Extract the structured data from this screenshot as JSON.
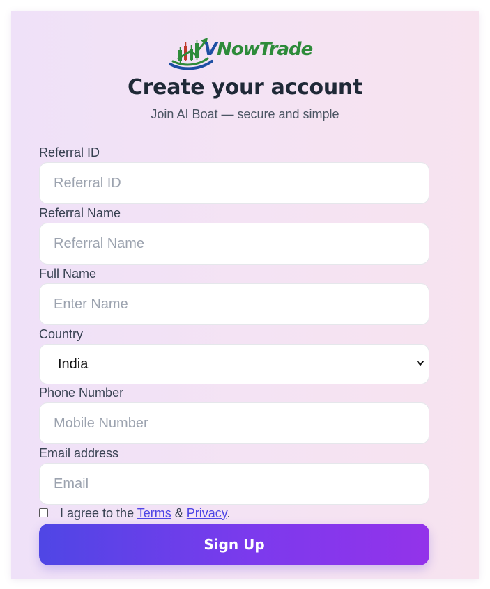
{
  "brand": {
    "logo_text_v": "V",
    "logo_text_rest": "NowTrade"
  },
  "header": {
    "title": "Create your account",
    "subtitle": "Join AI Boat — secure and simple"
  },
  "form": {
    "referral_id": {
      "label": "Referral ID",
      "placeholder": "Referral ID",
      "value": ""
    },
    "referral_name": {
      "label": "Referral Name",
      "placeholder": "Referral Name",
      "value": ""
    },
    "full_name": {
      "label": "Full Name",
      "placeholder": "Enter Name",
      "value": ""
    },
    "country": {
      "label": "Country",
      "selected": "India"
    },
    "phone": {
      "label": "Phone Number",
      "placeholder": "Mobile Number",
      "value": ""
    },
    "email": {
      "label": "Email address",
      "placeholder": "Email",
      "value": ""
    },
    "agree": {
      "checked": false,
      "prefix": "I agree to the ",
      "terms_link": "Terms",
      "middle": " & ",
      "privacy_link": "Privacy",
      "suffix": "."
    },
    "submit_label": "Sign Up"
  },
  "colors": {
    "accent": "#4f46e5",
    "accent_end": "#9333ea",
    "title": "#1f2937",
    "logo_blue": "#1d4fa3",
    "logo_green": "#2e8b3a"
  },
  "icons": {
    "logo": "vnowtrade-chart-logo",
    "select_caret": "chevron-down-icon"
  }
}
